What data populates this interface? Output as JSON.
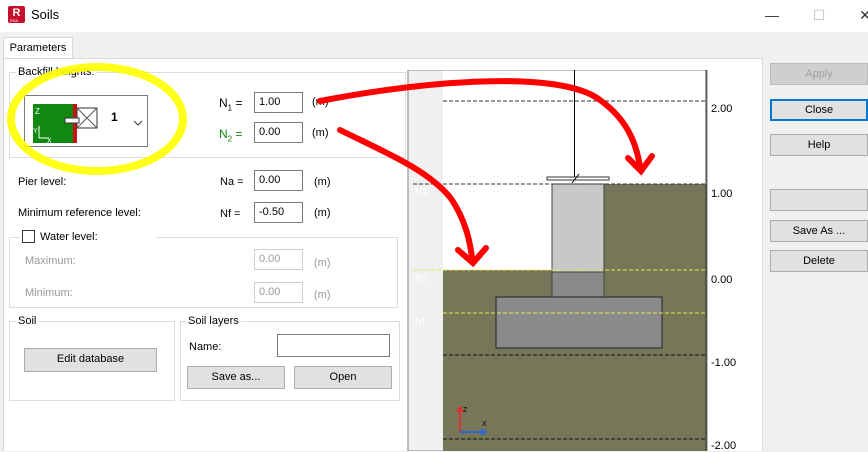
{
  "window": {
    "title": "Soils",
    "icon_letter": "R",
    "icon_sub": "RSA"
  },
  "tabs": [
    {
      "label": "Parameters"
    }
  ],
  "backfill": {
    "label": "Backfill heights:",
    "selected_value": "1",
    "thumb_z": "Z",
    "thumb_y": "Y",
    "thumb_x": "X",
    "n1_symbol": "N",
    "n1_sub": "1",
    "n1_eq": "=",
    "n1_value": "1.00",
    "n1_unit": "(m)",
    "n2_symbol": "N",
    "n2_sub": "2",
    "n2_eq": "=",
    "n2_value": "0.00",
    "n2_unit": "(m)"
  },
  "pier_level": {
    "label": "Pier level:",
    "symbol": "Na =",
    "value": "0.00",
    "unit": "(m)"
  },
  "min_ref_level": {
    "label": "Minimum reference level:",
    "symbol": "Nf =",
    "value": "-0.50",
    "unit": "(m)"
  },
  "water_level": {
    "label": "Water level:",
    "checked": false,
    "maximum_label": "Maximum:",
    "maximum_value": "0.00",
    "maximum_unit": "(m)",
    "minimum_label": "Minimum:",
    "minimum_value": "0.00",
    "minimum_unit": "(m)"
  },
  "soil": {
    "label": "Soil",
    "edit_database": "Edit database"
  },
  "soil_layers": {
    "label": "Soil layers",
    "name_label": "Name:",
    "name_value": "",
    "save_as": "Save as...",
    "open": "Open"
  },
  "side_buttons": {
    "apply": "Apply",
    "close": "Close",
    "help": "Help",
    "blank": "",
    "save_as": "Save As ...",
    "delete": "Delete"
  },
  "diagram": {
    "levels": {
      "n1": "N1",
      "n2": "N2",
      "nf": "Nf"
    },
    "scale": {
      "t200": "2.00",
      "t100": "1.00",
      "t000": "0.00",
      "tm100": "-1.00",
      "tm200": "-2.00"
    },
    "axis_z": "Z",
    "axis_x": "X",
    "colors": {
      "soil": "#767659",
      "concrete_light": "#c8c8c8",
      "concrete_dark": "#8a8a8a"
    }
  },
  "annotations": {
    "highlight_color": "#ffff00",
    "arrow_color": "#ff0000"
  }
}
